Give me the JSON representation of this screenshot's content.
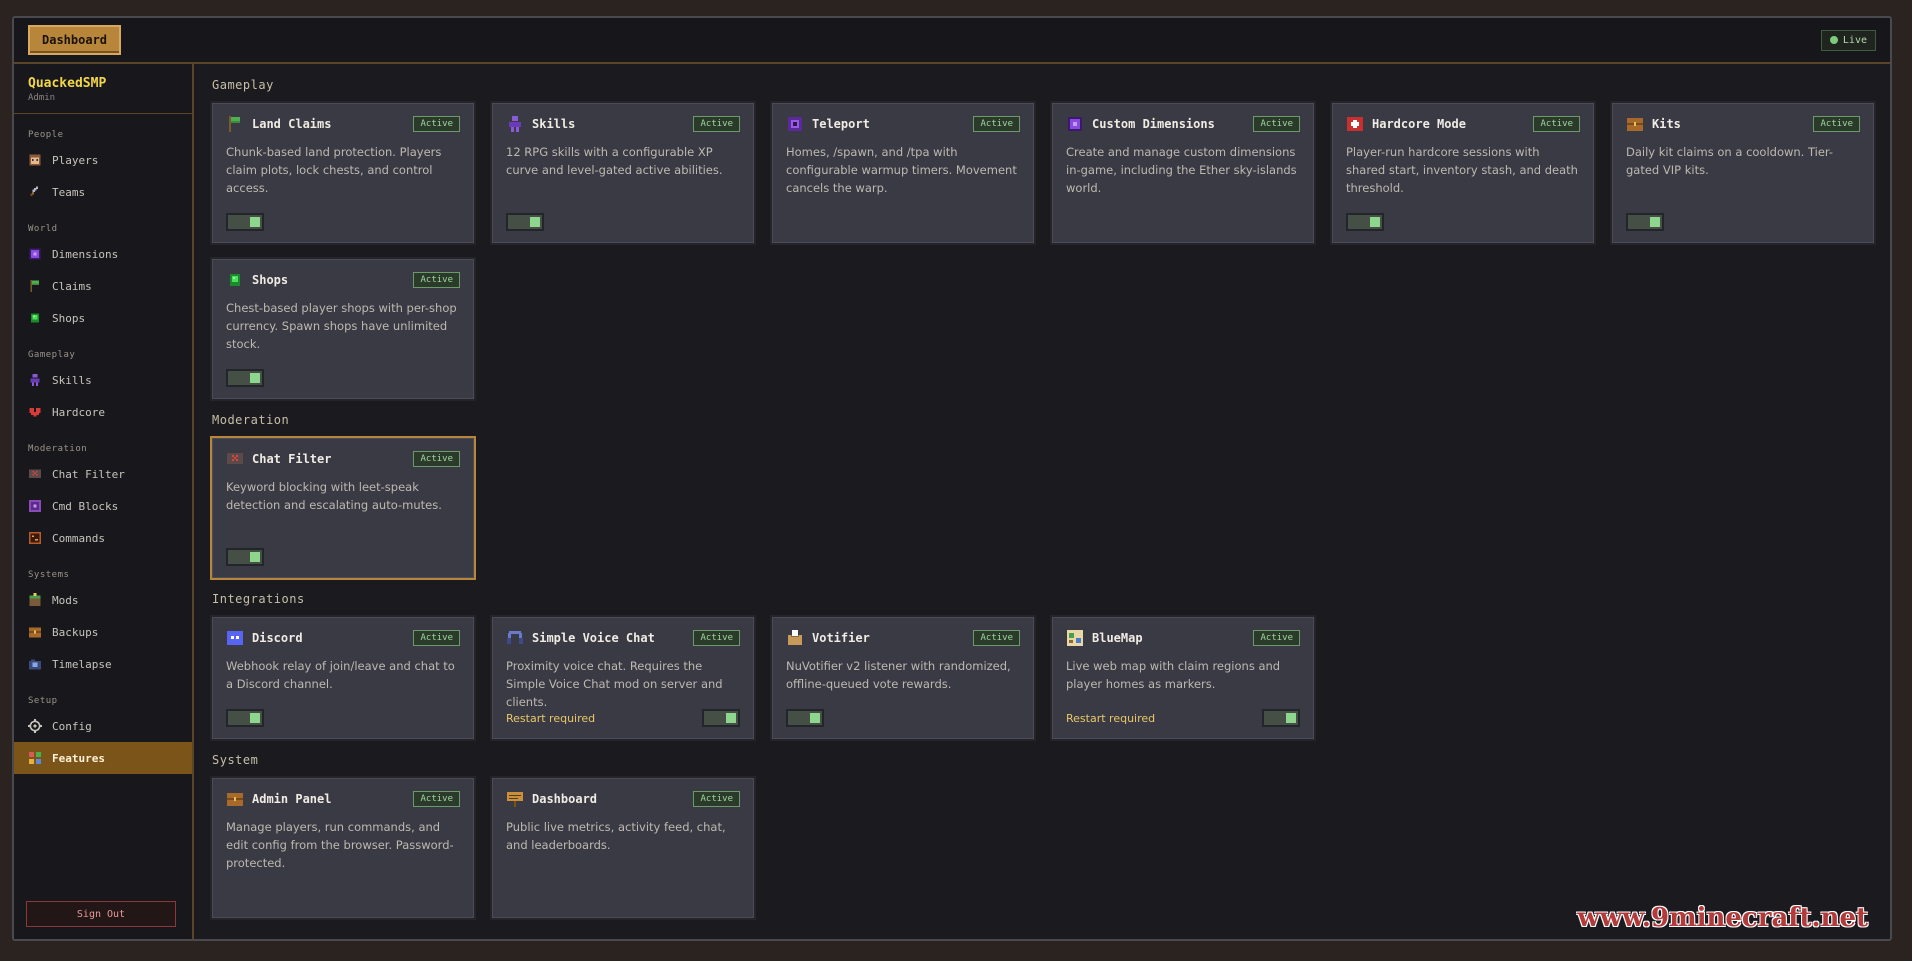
{
  "topbar": {
    "dashboard_label": "Dashboard",
    "live_label": "Live"
  },
  "sidebar": {
    "server_name": "QuackedSMP",
    "role": "Admin",
    "sections": [
      {
        "title": "People",
        "items": [
          {
            "label": "Players",
            "icon": "player-head-icon"
          },
          {
            "label": "Teams",
            "icon": "sword-icon"
          }
        ]
      },
      {
        "title": "World",
        "items": [
          {
            "label": "Dimensions",
            "icon": "portal-icon"
          },
          {
            "label": "Claims",
            "icon": "flag-icon"
          },
          {
            "label": "Shops",
            "icon": "emerald-icon"
          }
        ]
      },
      {
        "title": "Gameplay",
        "items": [
          {
            "label": "Skills",
            "icon": "skill-figure-icon"
          },
          {
            "label": "Hardcore",
            "icon": "heart-icon"
          }
        ]
      },
      {
        "title": "Moderation",
        "items": [
          {
            "label": "Chat Filter",
            "icon": "chat-block-icon"
          },
          {
            "label": "Cmd Blocks",
            "icon": "command-block-icon"
          },
          {
            "label": "Commands",
            "icon": "terminal-icon"
          }
        ]
      },
      {
        "title": "Systems",
        "items": [
          {
            "label": "Mods",
            "icon": "grass-block-icon"
          },
          {
            "label": "Backups",
            "icon": "chest-icon"
          },
          {
            "label": "Timelapse",
            "icon": "camera-icon"
          }
        ]
      },
      {
        "title": "Setup",
        "items": [
          {
            "label": "Config",
            "icon": "gear-icon"
          },
          {
            "label": "Features",
            "icon": "grid-icon",
            "active": true
          }
        ]
      }
    ],
    "signout_label": "Sign Out"
  },
  "sections": [
    {
      "title": "Gameplay",
      "cards": [
        {
          "title": "Land Claims",
          "badge": "Active",
          "desc": "Chunk-based land protection. Players claim plots, lock chests, and control access.",
          "icon": "flag-icon",
          "enabled": true
        },
        {
          "title": "Skills",
          "badge": "Active",
          "desc": "12 RPG skills with a configurable XP curve and level-gated active abilities.",
          "icon": "skill-figure-icon",
          "enabled": true
        },
        {
          "title": "Teleport",
          "badge": "Active",
          "desc": "Homes, /spawn, and /tpa with configurable warmup timers. Movement cancels the warp.",
          "icon": "ender-pearl-icon"
        },
        {
          "title": "Custom Dimensions",
          "badge": "Active",
          "desc": "Create and manage custom dimensions in-game, including the Ether sky-islands world.",
          "icon": "portal-icon"
        },
        {
          "title": "Hardcore Mode",
          "badge": "Active",
          "desc": "Player-run hardcore sessions with shared start, inventory stash, and death threshold.",
          "icon": "medkit-icon",
          "enabled": true
        },
        {
          "title": "Kits",
          "badge": "Active",
          "desc": "Daily kit claims on a cooldown. Tier-gated VIP kits.",
          "icon": "chest-icon",
          "enabled": true
        },
        {
          "title": "Shops",
          "badge": "Active",
          "desc": "Chest-based player shops with per-shop currency. Spawn shops have unlimited stock.",
          "icon": "emerald-icon",
          "enabled": true
        }
      ]
    },
    {
      "title": "Moderation",
      "cards": [
        {
          "title": "Chat Filter",
          "badge": "Active",
          "desc": "Keyword blocking with leet-speak detection and escalating auto-mutes.",
          "icon": "chat-block-icon",
          "enabled": true,
          "highlight": true
        }
      ]
    },
    {
      "title": "Integrations",
      "cards": [
        {
          "title": "Discord",
          "badge": "Active",
          "desc": "Webhook relay of join/leave and chat to a Discord channel.",
          "icon": "discord-icon",
          "enabled": true
        },
        {
          "title": "Simple Voice Chat",
          "badge": "Active",
          "desc": "Proximity voice chat. Requires the Simple Voice Chat mod on server and clients.",
          "icon": "headset-icon",
          "enabled": true,
          "note": "Restart required"
        },
        {
          "title": "Votifier",
          "badge": "Active",
          "desc": "NuVotifier v2 listener with randomized, offline-queued vote rewards.",
          "icon": "ballot-box-icon",
          "enabled": true
        },
        {
          "title": "BlueMap",
          "badge": "Active",
          "desc": "Live web map with claim regions and player homes as markers.",
          "icon": "map-icon",
          "enabled": true,
          "note": "Restart required"
        }
      ]
    },
    {
      "title": "System",
      "cards": [
        {
          "title": "Admin Panel",
          "badge": "Active",
          "desc": "Manage players, run commands, and edit config from the browser. Password-protected.",
          "icon": "chest-icon"
        },
        {
          "title": "Dashboard",
          "badge": "Active",
          "desc": "Public live metrics, activity feed, chat, and leaderboards.",
          "icon": "sign-icon"
        }
      ]
    }
  ],
  "watermark": "www.9minecraft.net"
}
